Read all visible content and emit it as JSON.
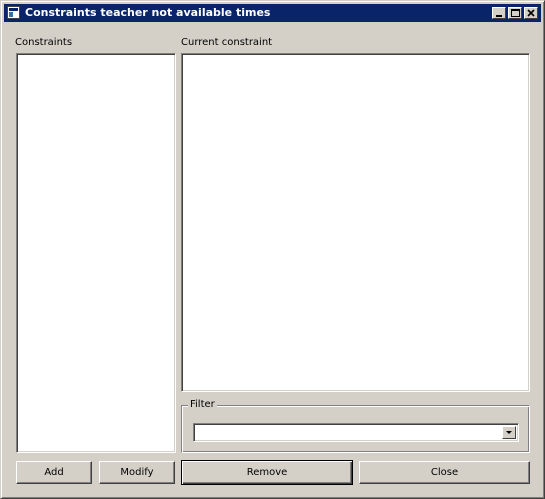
{
  "window": {
    "title": "Constraints teacher not available times"
  },
  "constraints_panel": {
    "label": "Constraints",
    "items": []
  },
  "current_constraint_panel": {
    "label": "Current constraint",
    "text": ""
  },
  "filter": {
    "label": "Filter",
    "selected": ""
  },
  "buttons": {
    "add": "Add",
    "modify": "Modify",
    "remove": "Remove",
    "close": "Close"
  },
  "colors": {
    "titlebar": "#0a246a",
    "face": "#d4d0c8"
  }
}
